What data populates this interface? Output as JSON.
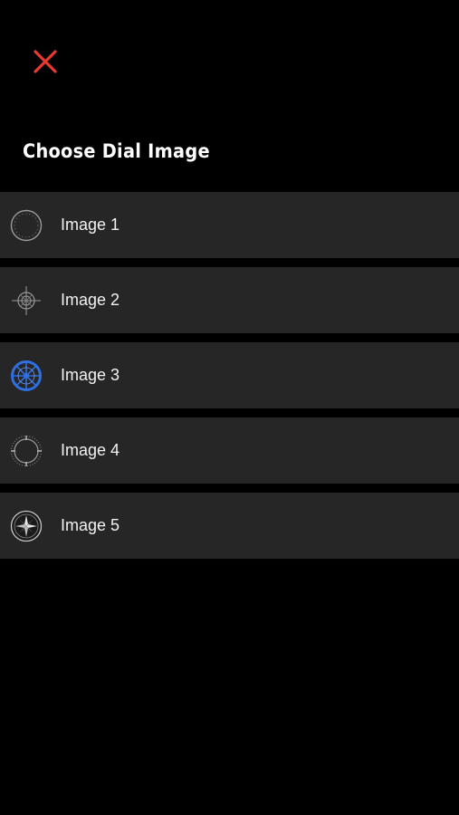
{
  "header": {
    "close_icon": "close-icon",
    "close_color": "#e8392f"
  },
  "page": {
    "title": "Choose Dial Image"
  },
  "dial_images": [
    {
      "label": "Image 1",
      "icon": "dial-ring-icon",
      "color": "#9a9a9a"
    },
    {
      "label": "Image 2",
      "icon": "dial-compass-icon",
      "color": "#9a9a9a"
    },
    {
      "label": "Image 3",
      "icon": "dial-wheel-icon",
      "color": "#2f6fe0"
    },
    {
      "label": "Image 4",
      "icon": "dial-ticks-icon",
      "color": "#9a9a9a"
    },
    {
      "label": "Image 5",
      "icon": "dial-compass-rose-icon",
      "color": "#c8c8c8"
    }
  ]
}
